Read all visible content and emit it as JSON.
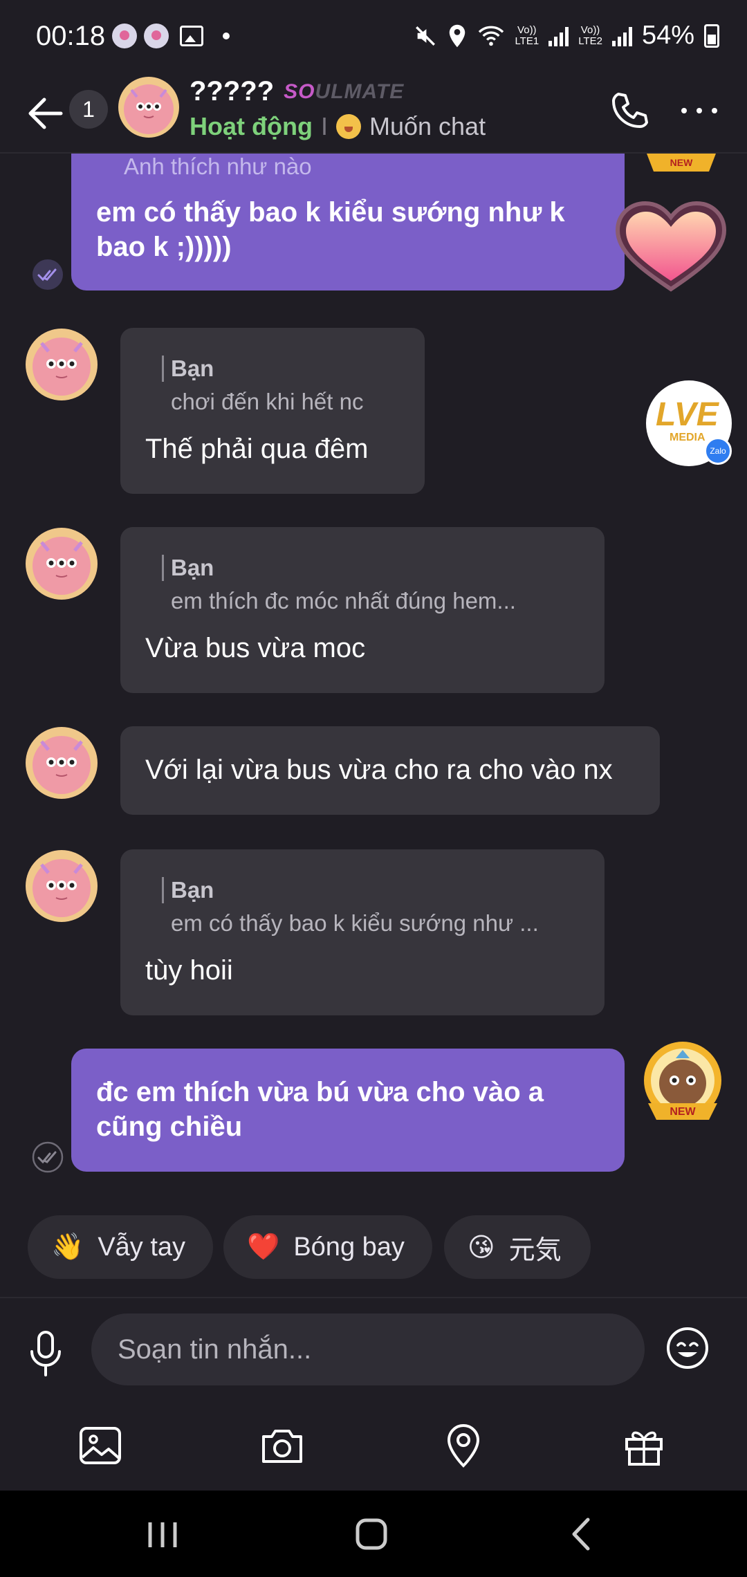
{
  "status_bar": {
    "time": "00:18",
    "battery": "54%",
    "sim1": "Vo))\nLTE1",
    "sim2": "Vo))\nLTE2"
  },
  "header": {
    "unread_count": "1",
    "name": "?????",
    "tag_prefix": "SO",
    "tag_rest": "ULMATE",
    "status_active": "Hoạt động",
    "status_separator": "I",
    "status_want": "Muốn chat"
  },
  "messages": {
    "m1": {
      "quote_fragment": "Anh thích như nào",
      "text": "em có thấy bao k kiểu sướng như k bao k ;)))))"
    },
    "m2": {
      "quote_author": "Bạn",
      "quote_text": "chơi đến khi hết nc",
      "text": "Thế phải qua đêm"
    },
    "m3": {
      "quote_author": "Bạn",
      "quote_text": "em thích đc móc nhất đúng hem...",
      "text": "Vừa bus vừa moc"
    },
    "m4": {
      "text": "Với lại vừa bus vừa cho ra cho vào nx"
    },
    "m5": {
      "quote_author": "Bạn",
      "quote_text": "em có thấy bao k kiểu sướng như ...",
      "text": "tùy hoii"
    },
    "m6": {
      "text": "đc em thích vừa bú vừa cho vào a cũng chiều"
    }
  },
  "badges": {
    "new_label": "NEW",
    "lve_label": "LVE",
    "lve_sub": "MEDIA",
    "zalo": "Zalo"
  },
  "quick_replies": [
    {
      "emoji": "👋",
      "label": "Vẫy tay"
    },
    {
      "emoji": "❤️",
      "label": "Bóng bay"
    },
    {
      "emoji": "😘",
      "label": "元気"
    }
  ],
  "composer": {
    "placeholder": "Soạn tin nhắn..."
  },
  "colors": {
    "background": "#1f1d24",
    "outgoing_bubble": "#7b5fc8",
    "incoming_bubble": "#37353c",
    "active_green": "#7ed17b"
  }
}
